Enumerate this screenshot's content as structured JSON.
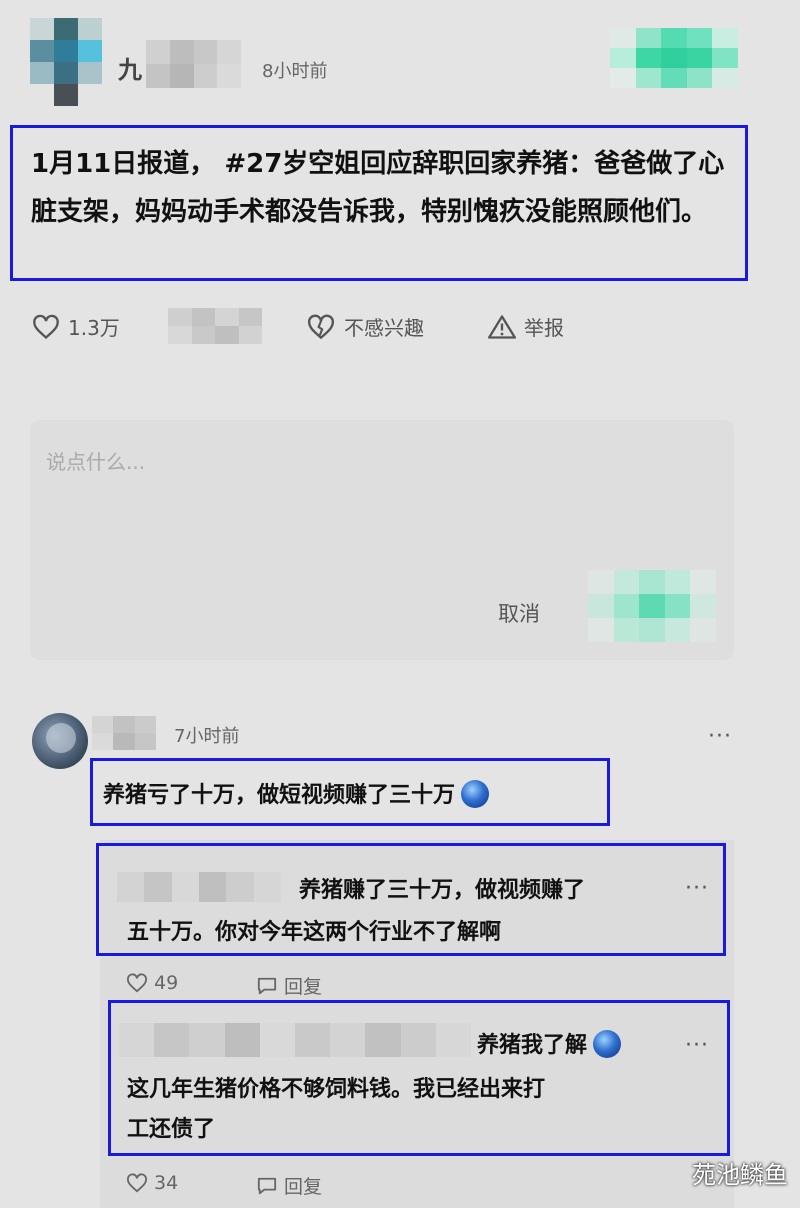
{
  "post": {
    "username": "九",
    "time": "8小时前",
    "text": "1月11日报道， #27岁空姐回应辞职回家养猪：爸爸做了心脏支架，妈妈动手术都没告诉我，特别愧疚没能照顾他们。",
    "like_count": "1.3万",
    "not_interested_label": "不感兴趣",
    "report_label": "举报"
  },
  "comment_input": {
    "placeholder": "说点什么...",
    "cancel_label": "取消"
  },
  "comments": [
    {
      "time": "7小时前",
      "text": "养猪亏了十万，做短视频赚了三十万",
      "more": "···"
    }
  ],
  "replies": [
    {
      "text_line1": "养猪赚了三十万，做视频赚了",
      "text_line2": "五十万。你对今年这两个行业不了解啊",
      "likes": "49",
      "reply_label": "回复",
      "more": "···"
    },
    {
      "text_line1": "养猪我了解",
      "text_line2": "这几年生猪价格不够饲料钱。我已经出来打",
      "text_line3": "工还债了",
      "likes": "34",
      "reply_label": "回复",
      "more": "···"
    }
  ],
  "watermark": "苑池鳞鱼",
  "colors": {
    "highlight_border": "#1a1adf",
    "background": "#e4e4e4",
    "teal_blur": "#3dd6a8"
  }
}
